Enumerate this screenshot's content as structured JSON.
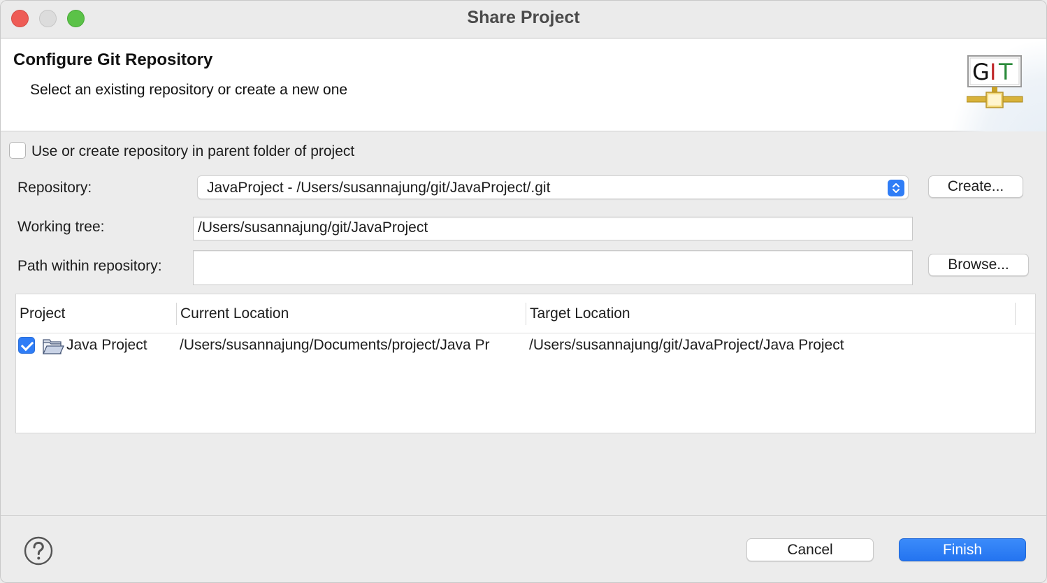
{
  "window": {
    "title": "Share Project"
  },
  "banner": {
    "title": "Configure Git Repository",
    "description": "Select an existing repository or create a new one",
    "logo_text": "GIT",
    "logo_icon": "git-logo-icon"
  },
  "options": {
    "parent_folder_label": "Use or create repository in parent folder of project",
    "parent_folder_checked": false
  },
  "form": {
    "repository_label": "Repository:",
    "repository_value": "JavaProject - /Users/susannajung/git/JavaProject/.git",
    "create_button": "Create...",
    "working_tree_label": "Working tree:",
    "working_tree_value": "/Users/susannajung/git/JavaProject",
    "path_label": "Path within repository:",
    "path_value": "",
    "browse_button": "Browse..."
  },
  "table": {
    "columns": [
      "Project",
      "Current Location",
      "Target Location"
    ],
    "rows": [
      {
        "checked": true,
        "project": "Java Project",
        "current_location": "/Users/susannajung/Documents/project/Java Pr",
        "target_location": "/Users/susannajung/git/JavaProject/Java Project",
        "icon": "open-folder-icon"
      }
    ]
  },
  "footer": {
    "cancel_button": "Cancel",
    "finish_button": "Finish",
    "help_icon": "help-icon"
  },
  "colors": {
    "accent": "#2f7df6",
    "close": "#ee5c56",
    "minimize": "#dcdcdc",
    "maximize": "#5bc248"
  }
}
